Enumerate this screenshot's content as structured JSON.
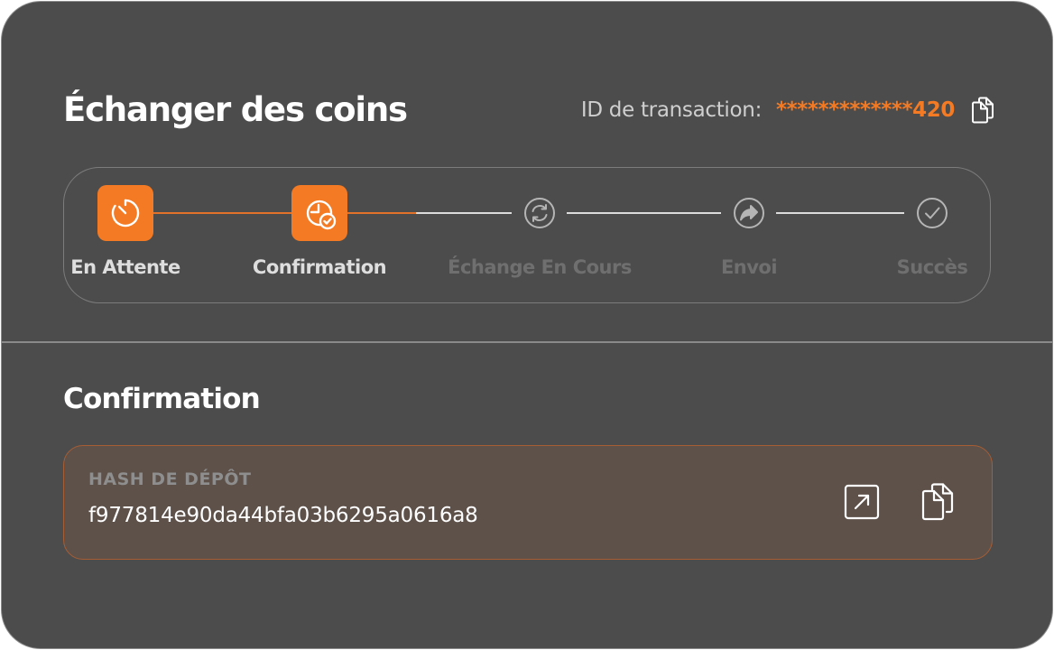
{
  "header": {
    "title": "Échanger des coins",
    "transaction_label": "ID de transaction:",
    "transaction_id": "*************420",
    "copy_icon": "copy-icon"
  },
  "steps": [
    {
      "label": "En Attente",
      "state": "completed",
      "icon": "timer-icon"
    },
    {
      "label": "Confirmation",
      "state": "active",
      "icon": "clock-check-icon"
    },
    {
      "label": "Échange En Cours",
      "state": "pending",
      "icon": "refresh-icon"
    },
    {
      "label": "Envoi",
      "state": "pending",
      "icon": "forward-arrow-icon"
    },
    {
      "label": "Succès",
      "state": "pending",
      "icon": "check-circle-icon"
    }
  ],
  "section": {
    "title": "Confirmation"
  },
  "deposit": {
    "label": "HASH DE DÉPÔT",
    "hash": "f977814e90da44bfa03b6295a0616a8",
    "open_icon": "external-link-icon",
    "copy_icon": "copy-icon"
  },
  "colors": {
    "accent": "#f47a23",
    "card_background": "#4c4c4c",
    "hash_box_background": "#5e514a",
    "hash_box_border": "#a65d34",
    "inactive_text": "#6f6f6f"
  }
}
